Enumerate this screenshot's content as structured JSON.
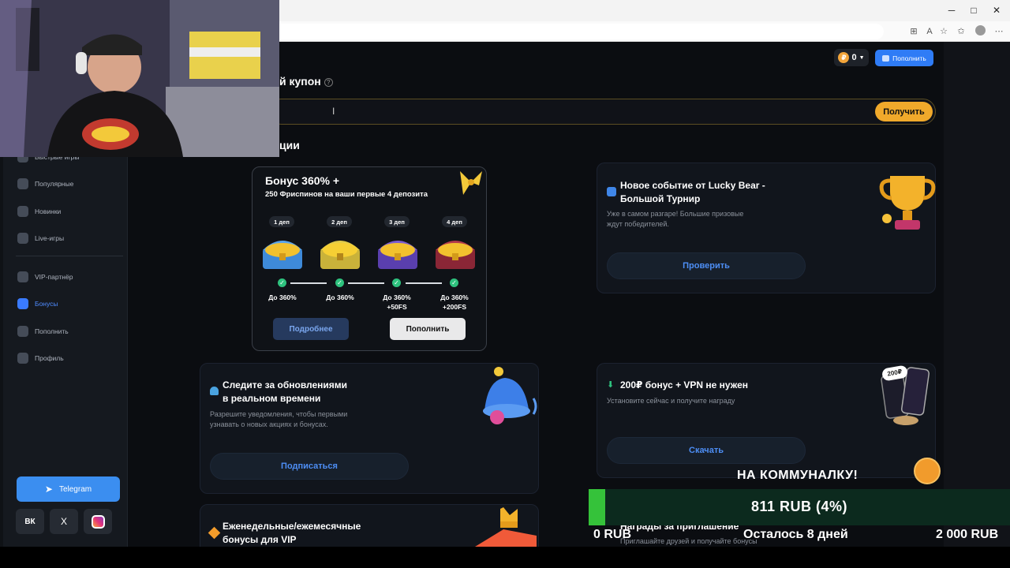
{
  "sidebar": {
    "items": [
      {
        "label": "Быстрые игры",
        "active": false
      },
      {
        "label": "Популярные",
        "active": false
      },
      {
        "label": "Новинки",
        "active": false
      },
      {
        "label": "Live-игры",
        "active": false
      },
      {
        "label": "VIP-партнёр",
        "active": false
      },
      {
        "label": "Бонусы",
        "active": true
      },
      {
        "label": "Пополнить",
        "active": false
      },
      {
        "label": "Профиль",
        "active": false
      }
    ],
    "telegram_label": "Telegram",
    "socials": [
      "ВК",
      "X",
      "Instagram"
    ]
  },
  "header": {
    "balance": "0",
    "deposit_label": "Пополнить"
  },
  "coupon": {
    "title": "й купон",
    "button_label": "Получить"
  },
  "promos_title": "ции",
  "bonus_card": {
    "title": "Бонус 360% +",
    "subtitle": "250 Фриспинов на ваши первые 4 депозита",
    "steps": [
      {
        "dep": "1 деп",
        "pct": "До 360%",
        "extra": ""
      },
      {
        "dep": "2 деп",
        "pct": "До 360%",
        "extra": ""
      },
      {
        "dep": "3 деп",
        "pct": "До 360%",
        "extra": "+50FS"
      },
      {
        "dep": "4 деп",
        "pct": "До 360%",
        "extra": "+200FS"
      }
    ],
    "more_label": "Подробнее",
    "deposit_label": "Пополнить"
  },
  "tournament_card": {
    "title_line1": "Новое событие от Lucky Bear -",
    "title_line2": "Большой Турнир",
    "desc_line1": "Уже в самом разгаре! Большие призовые",
    "desc_line2": "ждут победителей.",
    "button_label": "Проверить"
  },
  "notify_card": {
    "title_line1": "Следите за обновлениями",
    "title_line2": "в реальном времени",
    "desc_line1": "Разрешите уведомления, чтобы первыми",
    "desc_line2": "узнавать о новых акциях и бонусах.",
    "button_label": "Подписаться"
  },
  "vpn_card": {
    "title": "200₽ бонус + VPN не нужен",
    "desc": "Установите сейчас и получите награду",
    "button_label": "Скачать",
    "badge": "200₽"
  },
  "vip_card": {
    "title_line1": "Еженедельные/ежемесячные",
    "title_line2": "бонусы для VIP"
  },
  "invite_card": {
    "title": "Награды за приглашение",
    "desc": "Приглашайте друзей и получайте бонусы"
  },
  "donation_overlay": {
    "title": "НА КОММУНАЛКУ!",
    "current": "811 RUB (4%)",
    "progress": 0.04,
    "min": "0 RUB",
    "remaining": "Осталось 8 дней",
    "goal": "2 000 RUB"
  },
  "colors": {
    "accent": "#2f7cf6",
    "coupon_button": "#f0a92b",
    "success": "#2ec27e",
    "progress_fill": "#35c23a"
  }
}
